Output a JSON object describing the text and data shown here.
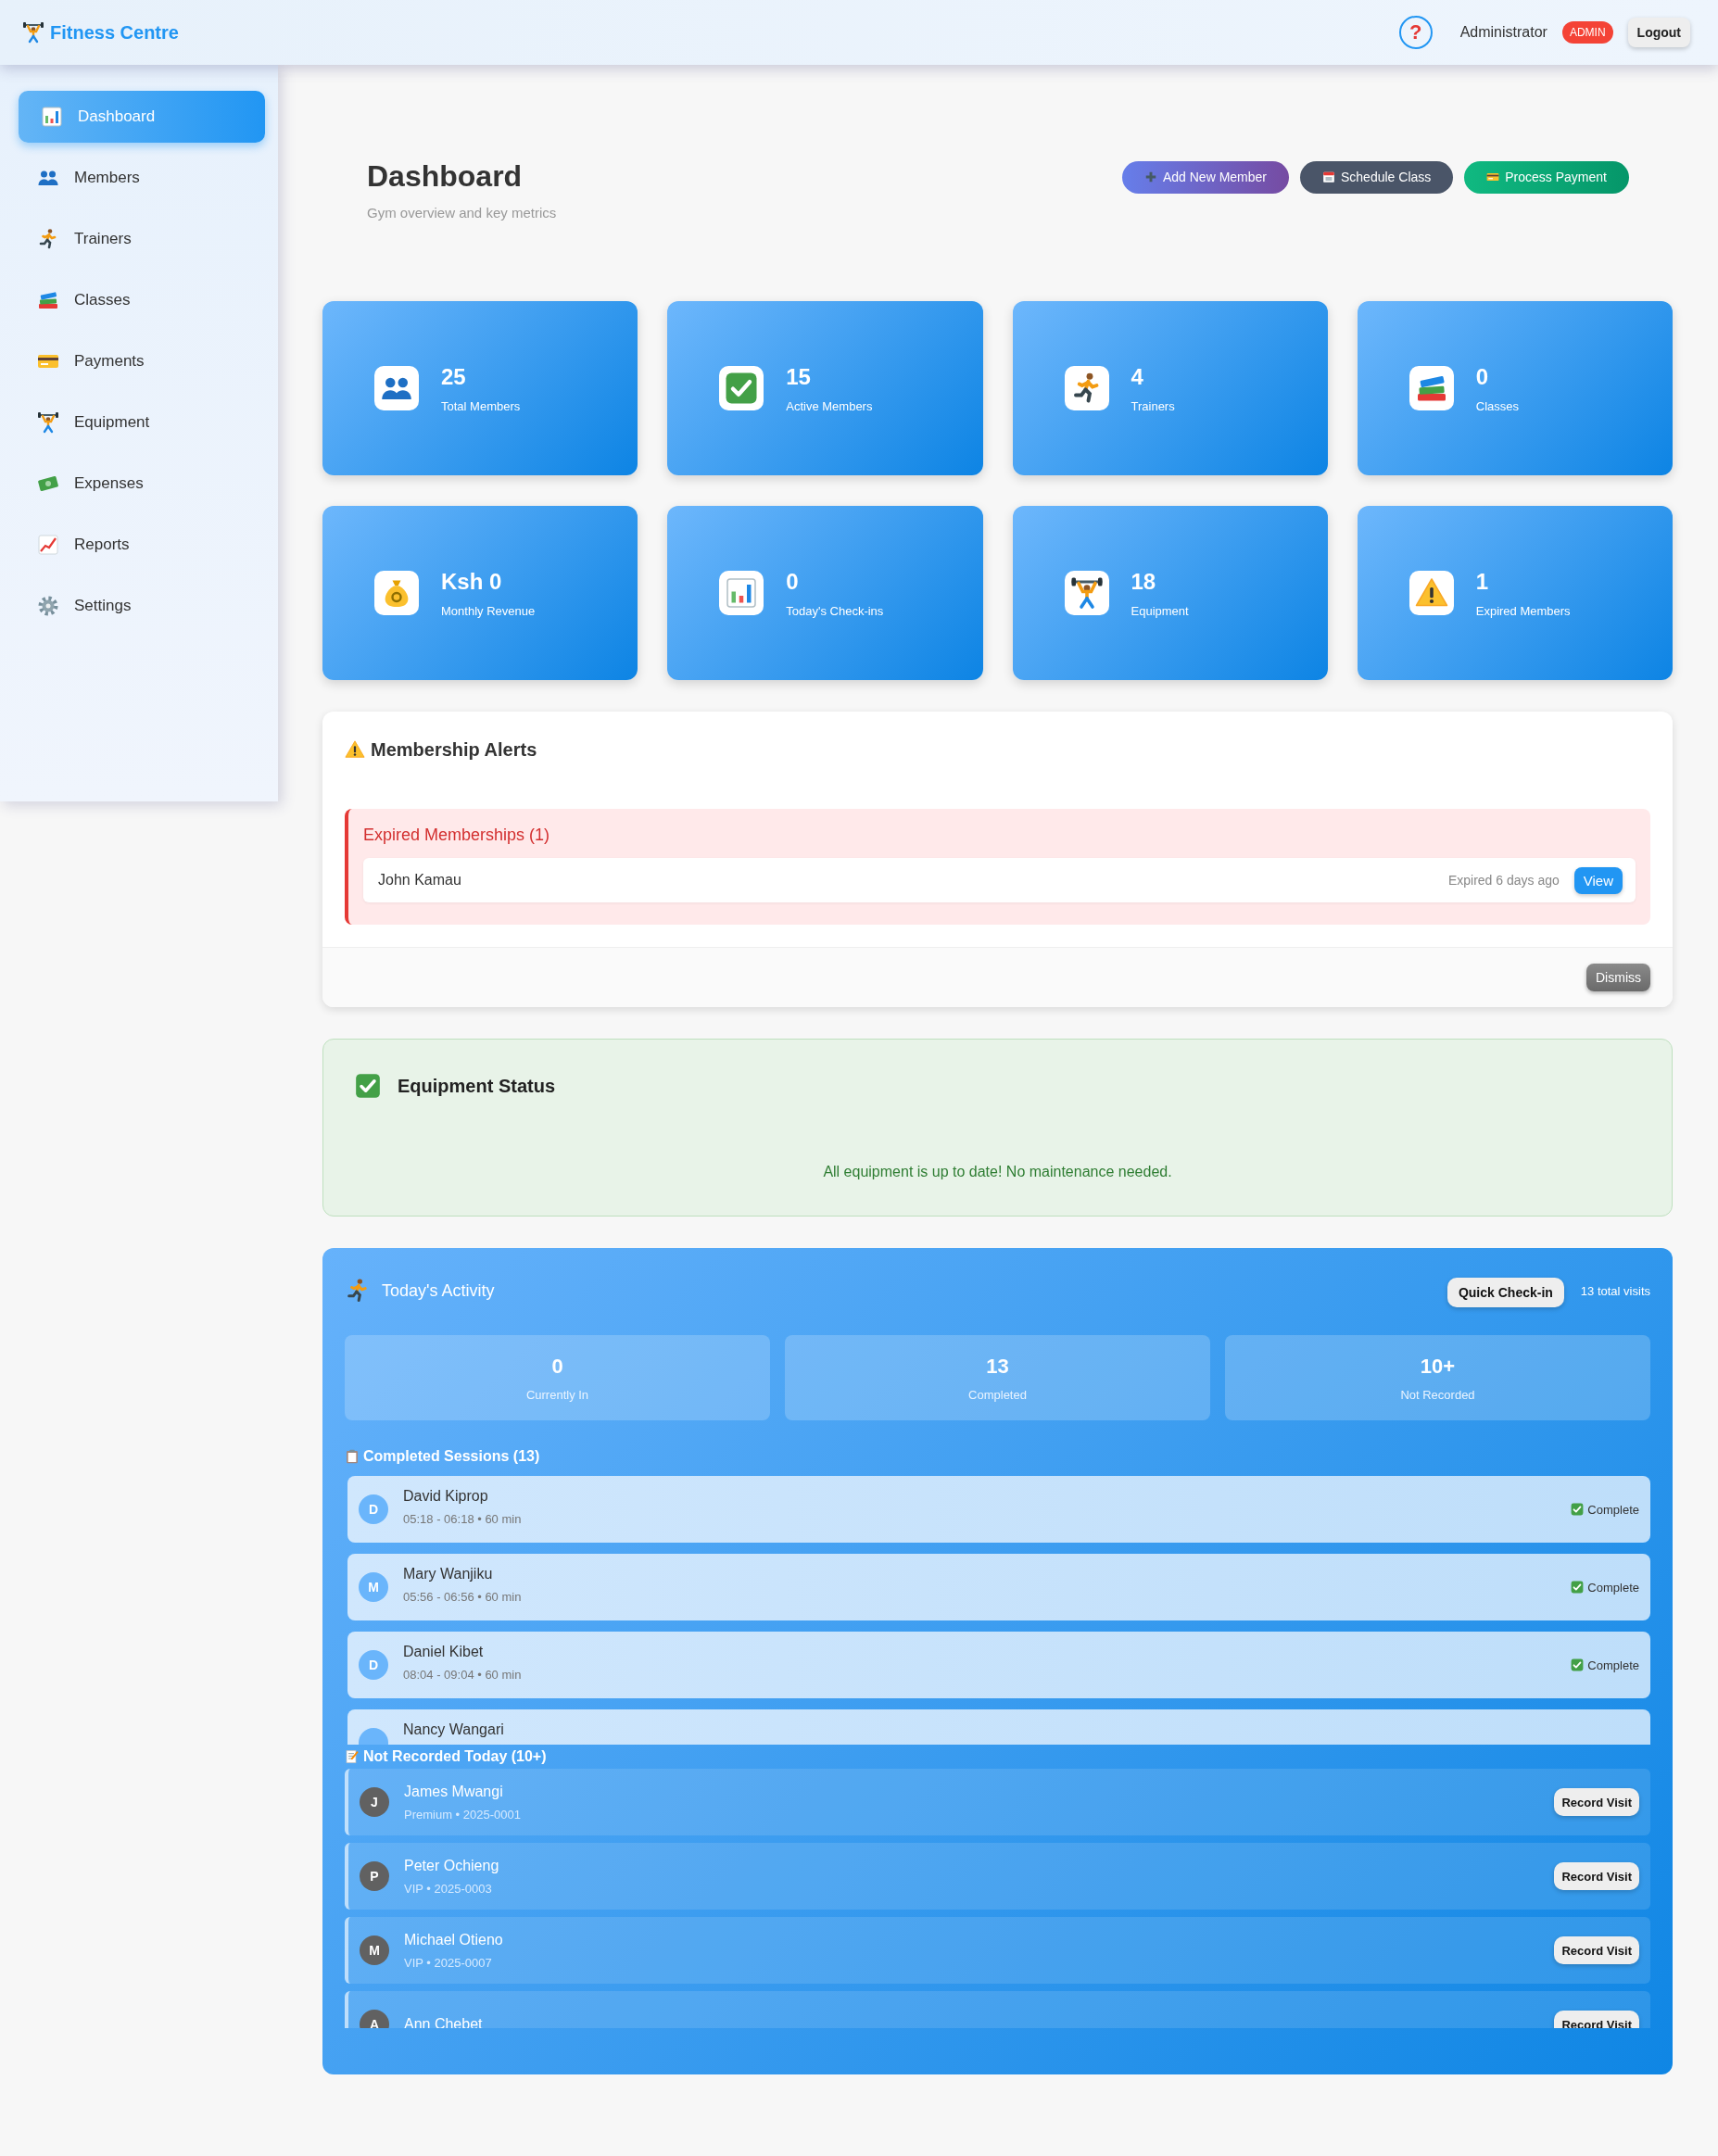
{
  "header": {
    "brand": "Fitness Centre",
    "help": "?",
    "user": "Administrator",
    "role_badge": "ADMIN",
    "logout": "Logout"
  },
  "sidebar": {
    "items": [
      {
        "label": "Dashboard",
        "selected": true
      },
      {
        "label": "Members",
        "selected": false
      },
      {
        "label": "Trainers",
        "selected": false
      },
      {
        "label": "Classes",
        "selected": false
      },
      {
        "label": "Payments",
        "selected": false
      },
      {
        "label": "Equipment",
        "selected": false
      },
      {
        "label": "Expenses",
        "selected": false
      },
      {
        "label": "Reports",
        "selected": false
      },
      {
        "label": "Settings",
        "selected": false
      }
    ]
  },
  "page": {
    "title": "Dashboard",
    "subtitle": "Gym overview and key metrics",
    "actions": [
      "Add New Member",
      "Schedule Class",
      "Process Payment"
    ]
  },
  "stats": [
    {
      "value": "25",
      "label": "Total Members"
    },
    {
      "value": "15",
      "label": "Active Members"
    },
    {
      "value": "4",
      "label": "Trainers"
    },
    {
      "value": "0",
      "label": "Classes"
    },
    {
      "value": "Ksh 0",
      "label": "Monthly Revenue"
    },
    {
      "value": "0",
      "label": "Today's Check-ins"
    },
    {
      "value": "18",
      "label": "Equipment"
    },
    {
      "value": "1",
      "label": "Expired Members"
    }
  ],
  "membership_alerts": {
    "title": "Membership Alerts",
    "group_title": "Expired Memberships (1)",
    "items": [
      {
        "name": "John Kamau",
        "note": "Expired 6 days ago",
        "action": "View"
      }
    ],
    "dismiss": "Dismiss"
  },
  "equipment_status": {
    "title": "Equipment Status",
    "message": "All equipment is up to date! No maintenance needed."
  },
  "todays_activity": {
    "title": "Today's Activity",
    "quick_checkin": "Quick Check-in",
    "total": "13 total visits",
    "summary": [
      {
        "value": "0",
        "label": "Currently In"
      },
      {
        "value": "13",
        "label": "Completed"
      },
      {
        "value": "10+",
        "label": "Not Recorded"
      }
    ],
    "completed_title": "Completed Sessions (13)",
    "completed": [
      {
        "initial": "D",
        "name": "David Kiprop",
        "time": "05:18 - 06:18 • 60 min",
        "status": "Complete"
      },
      {
        "initial": "M",
        "name": "Mary Wanjiku",
        "time": "05:56 - 06:56 • 60 min",
        "status": "Complete"
      },
      {
        "initial": "D",
        "name": "Daniel Kibet",
        "time": "08:04 - 09:04 • 60 min",
        "status": "Complete"
      },
      {
        "name": "Nancy Wangari"
      }
    ],
    "not_recorded_title": "Not Recorded Today (10+)",
    "not_recorded": [
      {
        "initial": "J",
        "name": "James Mwangi",
        "detail": "Premium • 2025-0001",
        "action": "Record Visit"
      },
      {
        "initial": "P",
        "name": "Peter Ochieng",
        "detail": "VIP • 2025-0003",
        "action": "Record Visit"
      },
      {
        "initial": "M",
        "name": "Michael Otieno",
        "detail": "VIP • 2025-0007",
        "action": "Record Visit"
      },
      {
        "initial": "A",
        "name": "Ann Chebet",
        "action": "Record Visit"
      }
    ]
  }
}
